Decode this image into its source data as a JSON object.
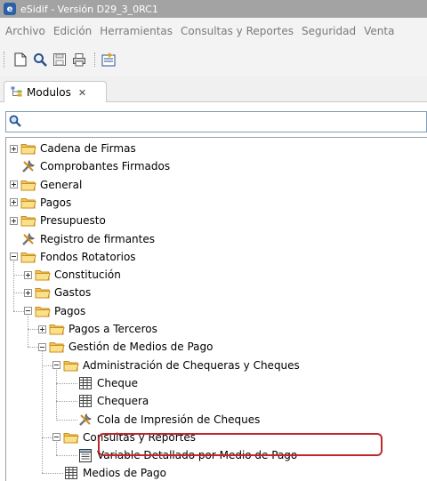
{
  "window": {
    "title": "eSidif - Versión D29_3_0RC1"
  },
  "menu": [
    "Archivo",
    "Edición",
    "Herramientas",
    "Consultas y Reportes",
    "Seguridad",
    "Venta"
  ],
  "toolbar": {
    "buttons": [
      "new-document-icon",
      "search-icon",
      "save-icon",
      "print-icon",
      "export-icon"
    ]
  },
  "tab": {
    "label": "Modulos",
    "close_symbol": "✕"
  },
  "search": {
    "value": "",
    "placeholder": ""
  },
  "tree": [
    {
      "label": "Cadena de Firmas",
      "level": 0,
      "type": "folder",
      "expanded": false
    },
    {
      "label": "Comprobantes Firmados",
      "level": 0,
      "type": "tool"
    },
    {
      "label": "General",
      "level": 0,
      "type": "folder",
      "expanded": false
    },
    {
      "label": "Pagos",
      "level": 0,
      "type": "folder",
      "expanded": false
    },
    {
      "label": "Presupuesto",
      "level": 0,
      "type": "folder",
      "expanded": false
    },
    {
      "label": "Registro de firmantes",
      "level": 0,
      "type": "tool"
    },
    {
      "label": "Fondos Rotatorios",
      "level": 0,
      "type": "folder",
      "expanded": true
    },
    {
      "label": "Constitución",
      "level": 1,
      "type": "folder",
      "expanded": false
    },
    {
      "label": "Gastos",
      "level": 1,
      "type": "folder",
      "expanded": false
    },
    {
      "label": "Pagos",
      "level": 1,
      "type": "folder",
      "expanded": true
    },
    {
      "label": "Pagos a Terceros",
      "level": 2,
      "type": "folder",
      "expanded": false
    },
    {
      "label": "Gestión de Medios de Pago",
      "level": 2,
      "type": "folder",
      "expanded": true
    },
    {
      "label": "Administración de Chequeras y Cheques",
      "level": 3,
      "type": "folder",
      "expanded": true
    },
    {
      "label": "Cheque",
      "level": 4,
      "type": "grid"
    },
    {
      "label": "Chequera",
      "level": 4,
      "type": "grid"
    },
    {
      "label": "Cola de Impresión de Cheques",
      "level": 4,
      "type": "tool"
    },
    {
      "label": "Consultas y Reportes",
      "level": 3,
      "type": "folder",
      "expanded": true
    },
    {
      "label": "Variable Detallado por Medio de Pago",
      "level": 4,
      "type": "report",
      "highlighted": true
    },
    {
      "label": "Medios de Pago",
      "level": 3,
      "type": "grid"
    }
  ],
  "colors": {
    "folder": "#f2c45a",
    "folder_dark": "#c98f1e",
    "highlight": "#c0272d",
    "titlebar": "#a3a3a3"
  }
}
